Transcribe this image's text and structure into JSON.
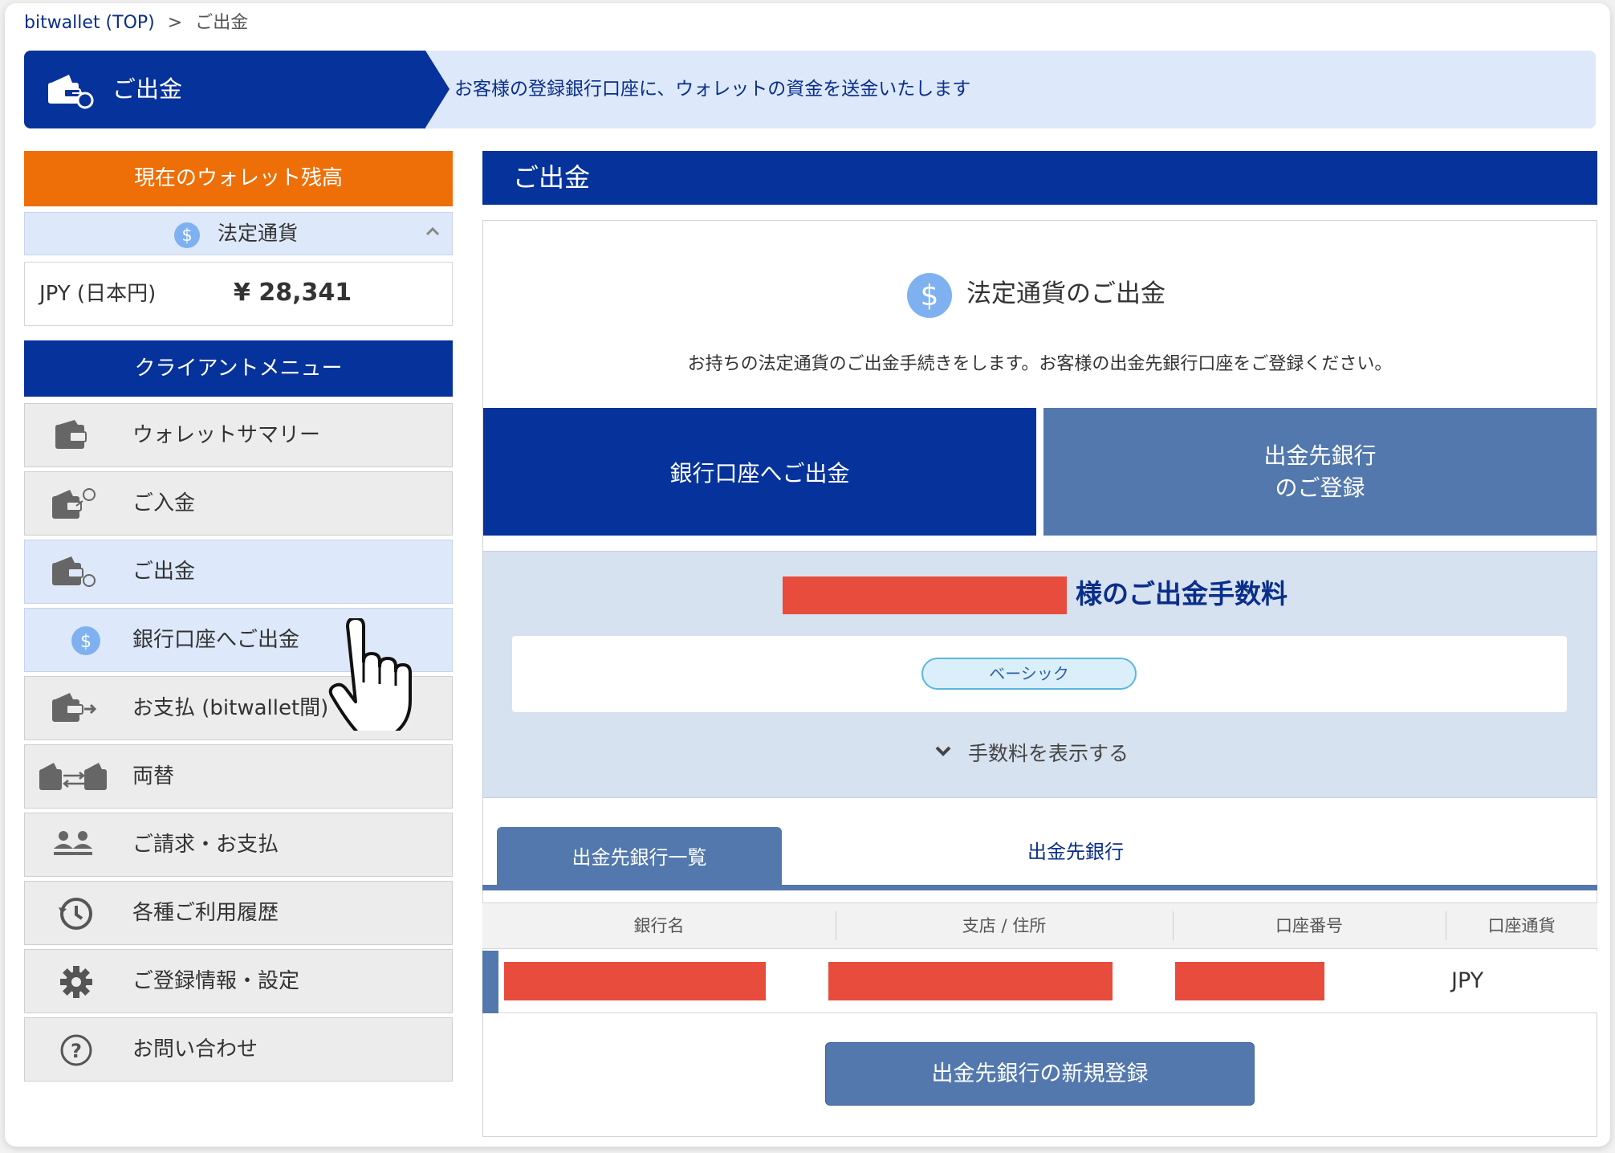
{
  "breadcrumb": {
    "home": "bitwallet (TOP)",
    "separator": ">",
    "current": "ご出金"
  },
  "hero": {
    "title": "ご出金",
    "description": "お客様の登録銀行口座に、ウォレットの資金を送金いたします",
    "icon": "withdraw-wallet-icon"
  },
  "sidebar": {
    "balance_title": "現在のウォレット残高",
    "fiat_label": "法定通貨",
    "currency": "JPY (日本円)",
    "amount": "¥ 28,341",
    "menu_title": "クライアントメニュー",
    "items": [
      {
        "label": "ウォレットサマリー",
        "icon": "wallet-icon"
      },
      {
        "label": "ご入金",
        "icon": "deposit-icon"
      },
      {
        "label": "ご出金",
        "icon": "withdraw-icon"
      },
      {
        "label": "銀行口座へご出金",
        "icon": "dollar-coin-icon"
      },
      {
        "label": "お支払 (bitwallet間)",
        "icon": "payment-icon"
      },
      {
        "label": "両替",
        "icon": "exchange-icon"
      },
      {
        "label": "ご請求・お支払",
        "icon": "users-icon"
      },
      {
        "label": "各種ご利用履歴",
        "icon": "history-icon"
      },
      {
        "label": "ご登録情報・設定",
        "icon": "gear-icon"
      },
      {
        "label": "お問い合わせ",
        "icon": "question-icon"
      }
    ]
  },
  "main": {
    "title": "ご出金",
    "fiat_title": "法定通貨のご出金",
    "intro": "お持ちの法定通貨のご出金手続きをします。お客様の出金先銀行口座をご登録ください。",
    "withdraw_button": "銀行口座へご出金",
    "register_button_line1": "出金先銀行",
    "register_button_line2": "のご登録",
    "fee_title_suffix": "様のご出金手数料",
    "plan": "ベーシック",
    "fee_toggle": "手数料を表示する",
    "tab_list": "出金先銀行一覧",
    "tab_bank": "出金先銀行",
    "columns": [
      "銀行名",
      "支店 / 住所",
      "口座番号",
      "口座通貨"
    ],
    "row_currency": "JPY",
    "new_bank_button": "出金先銀行の新規登録"
  },
  "colors": {
    "navy": "#06329b",
    "steel": "#5278ad",
    "orange": "#ee6f07",
    "light_blue": "#dde8fb",
    "redact": "#e84c3d"
  }
}
